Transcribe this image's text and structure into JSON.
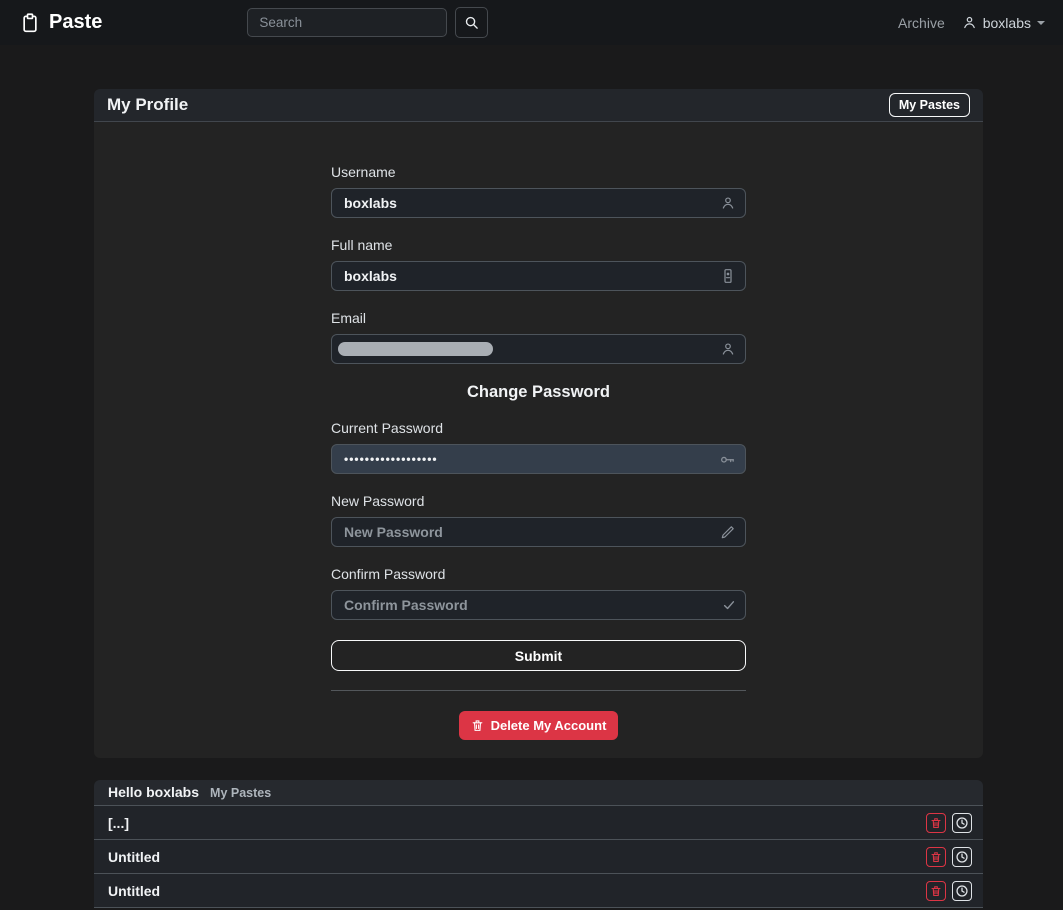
{
  "navbar": {
    "brand": "Paste",
    "search": {
      "placeholder": "Search"
    },
    "archive_label": "Archive",
    "user": {
      "name": "boxlabs"
    }
  },
  "profile_card": {
    "title": "My Profile",
    "my_pastes_button": "My Pastes",
    "form": {
      "username": {
        "label": "Username",
        "value": "boxlabs"
      },
      "full_name": {
        "label": "Full name",
        "value": "boxlabs"
      },
      "email": {
        "label": "Email",
        "value_redacted": true
      },
      "change_password_heading": "Change Password",
      "current_password": {
        "label": "Current Password",
        "masked_value": "••••••••••••••••••"
      },
      "new_password": {
        "label": "New Password",
        "placeholder": "New Password"
      },
      "confirm_password": {
        "label": "Confirm Password",
        "placeholder": "Confirm Password"
      },
      "submit_label": "Submit",
      "delete_button_label": "Delete My Account"
    }
  },
  "pastes_card": {
    "greeting": "Hello boxlabs",
    "subtitle": "My Pastes",
    "rows": [
      {
        "title": "[...]"
      },
      {
        "title": "Untitled"
      },
      {
        "title": "Untitled"
      }
    ]
  },
  "colors": {
    "danger": "#dc3545",
    "navbar_bg": "#16181b",
    "page_bg": "#1a1a1b",
    "card_bg": "#232323"
  }
}
